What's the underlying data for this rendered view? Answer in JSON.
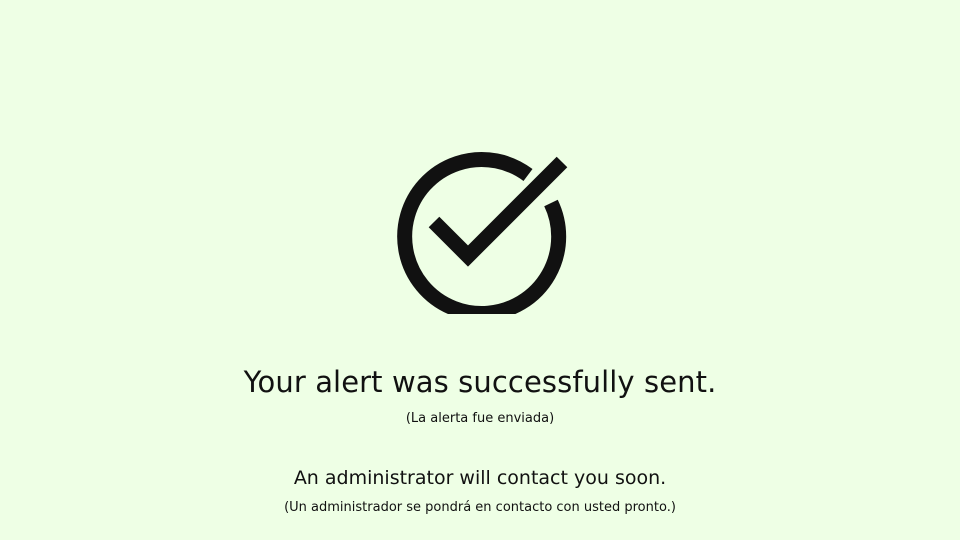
{
  "confirmation": {
    "icon": "check-circle-icon",
    "icon_color": "#111111",
    "background_color": "#EEFFE5",
    "headline": "Your alert was successfully sent.",
    "headline_translation": "(La alerta fue enviada)",
    "message": "An administrator will contact you soon.",
    "message_translation": "(Un administrador se pondrá en contacto con usted pronto.)"
  }
}
